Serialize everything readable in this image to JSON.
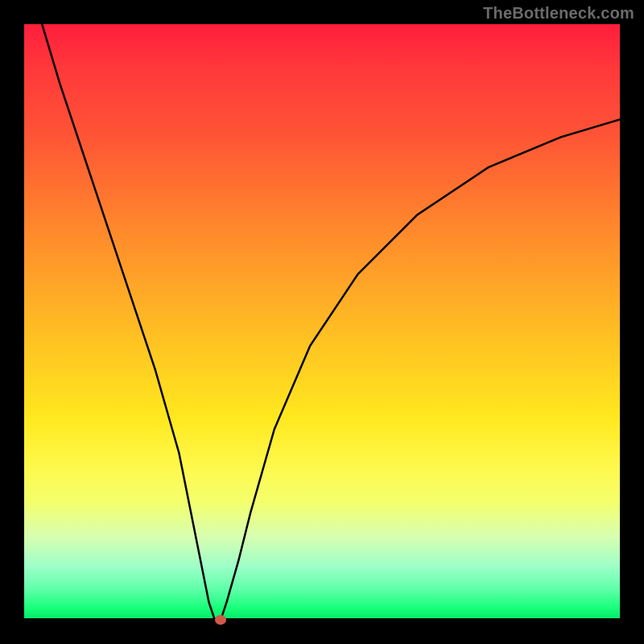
{
  "watermark": "TheBottleneck.com",
  "chart_data": {
    "type": "line",
    "title": "",
    "xlabel": "",
    "ylabel": "",
    "xlim": [
      0,
      100
    ],
    "ylim": [
      0,
      100
    ],
    "series": [
      {
        "name": "bottleneck-curve",
        "x": [
          3,
          6,
          10,
          14,
          18,
          22,
          26,
          28,
          30,
          31,
          32,
          33,
          34,
          36,
          38,
          42,
          48,
          56,
          66,
          78,
          90,
          100
        ],
        "values": [
          100,
          90,
          78,
          66,
          54,
          42,
          28,
          18,
          8,
          3,
          0,
          0,
          3,
          10,
          18,
          32,
          46,
          58,
          68,
          76,
          81,
          84
        ]
      }
    ],
    "annotations": [
      {
        "name": "optimal-marker",
        "x": 33,
        "y": 0,
        "color": "#d1594a"
      }
    ],
    "background_gradient": {
      "direction": "vertical",
      "stops": [
        {
          "pct": 0,
          "color": "#ff1e3c"
        },
        {
          "pct": 30,
          "color": "#ff7a2e"
        },
        {
          "pct": 66,
          "color": "#ffe81e"
        },
        {
          "pct": 100,
          "color": "#00e868"
        }
      ]
    }
  },
  "marker_color": "#d1594a"
}
